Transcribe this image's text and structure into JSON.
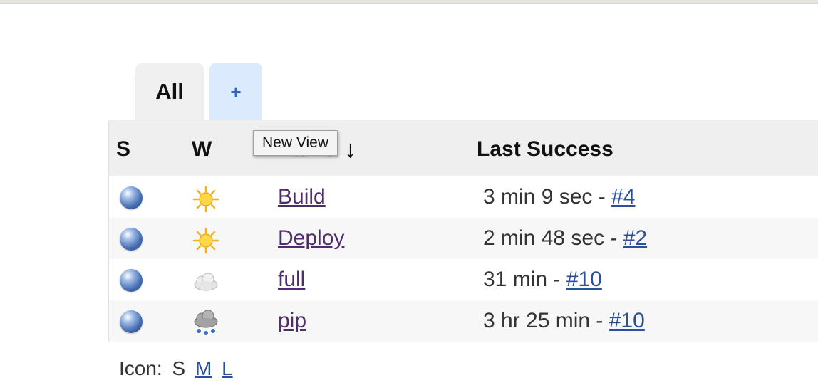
{
  "tabs": {
    "all_label": "All",
    "add_label": "+"
  },
  "table": {
    "headers": {
      "status": "S",
      "weather": "W",
      "name": "Name",
      "sort_arrow": "↓",
      "last_success": "Last Success"
    },
    "rows": [
      {
        "status_icon": "blue-ball-icon",
        "weather_icon": "sunny-icon",
        "name": "Build",
        "last_success_text": "3 min 9 sec - ",
        "build": "#4"
      },
      {
        "status_icon": "blue-ball-icon",
        "weather_icon": "sunny-icon",
        "name": "Deploy",
        "last_success_text": "2 min 48 sec - ",
        "build": "#2"
      },
      {
        "status_icon": "blue-ball-icon",
        "weather_icon": "cloudy-icon",
        "name": "full",
        "last_success_text": "31 min - ",
        "build": "#10"
      },
      {
        "status_icon": "blue-ball-icon",
        "weather_icon": "raining-icon",
        "name": "pip",
        "last_success_text": "3 hr 25 min - ",
        "build": "#10"
      }
    ]
  },
  "tooltip": {
    "text": "New View"
  },
  "icon_legend": {
    "label": "Icon:",
    "small": "S",
    "medium": "M",
    "large": "L"
  },
  "colors": {
    "tab_all_bg": "#f0f0f0",
    "tab_add_bg": "#dbeafc",
    "tab_add_fg": "#2e63c7",
    "visited_link": "#4d2d6b",
    "link": "#2a4f9c"
  }
}
